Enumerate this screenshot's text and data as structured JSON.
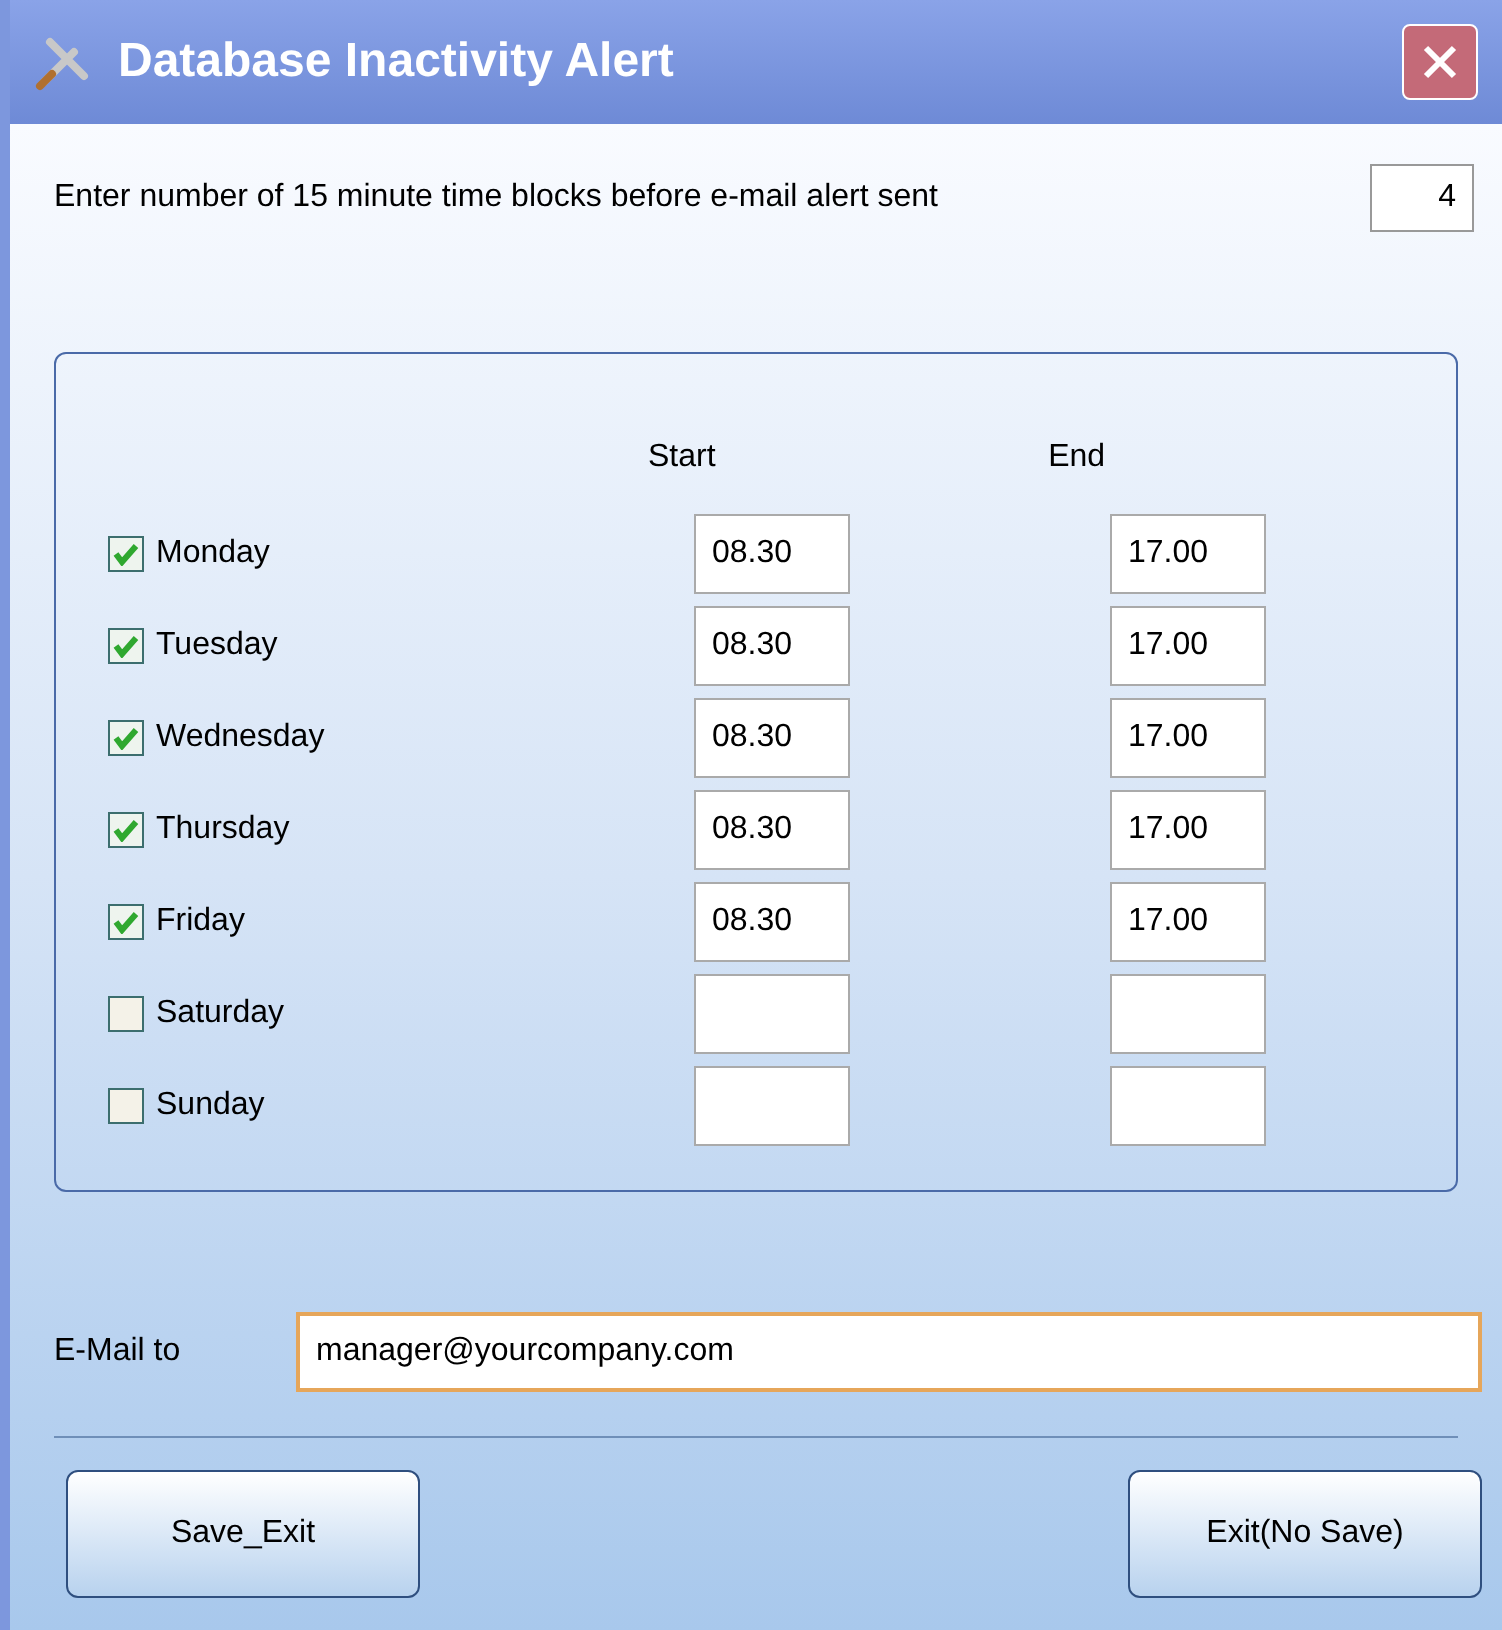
{
  "window": {
    "title": "Database Inactivity Alert"
  },
  "prompt": {
    "label": "Enter number of 15 minute time blocks before e-mail alert sent",
    "value": "4"
  },
  "schedule": {
    "columns": [
      "Start",
      "End"
    ],
    "rows": [
      {
        "day": "Monday",
        "checked": true,
        "start": "08.30",
        "end": "17.00"
      },
      {
        "day": "Tuesday",
        "checked": true,
        "start": "08.30",
        "end": "17.00"
      },
      {
        "day": "Wednesday",
        "checked": true,
        "start": "08.30",
        "end": "17.00"
      },
      {
        "day": "Thursday",
        "checked": true,
        "start": "08.30",
        "end": "17.00"
      },
      {
        "day": "Friday",
        "checked": true,
        "start": "08.30",
        "end": "17.00"
      },
      {
        "day": "Saturday",
        "checked": false
      },
      {
        "day": "Sunday",
        "checked": false
      }
    ]
  },
  "email": {
    "label": "E-Mail to",
    "value": "manager@yourcompany.com",
    "focused": true
  },
  "buttons": [
    "Save_Exit",
    "Exit(No Save)"
  ]
}
